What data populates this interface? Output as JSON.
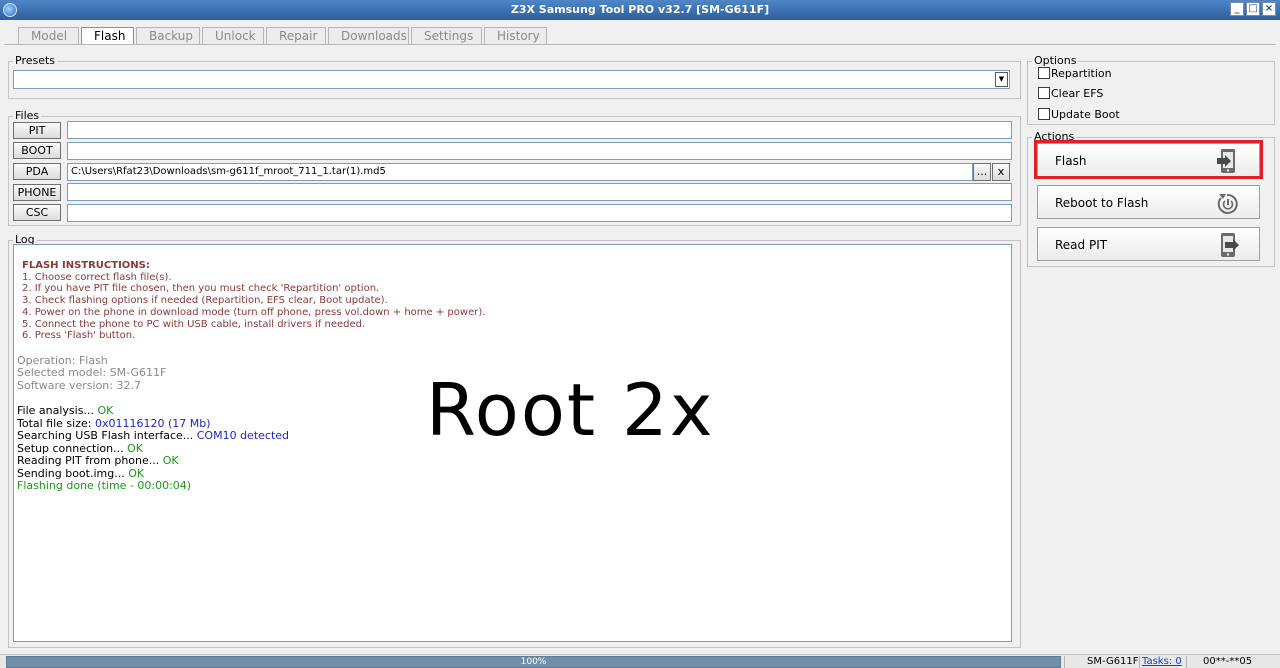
{
  "window": {
    "title": "Z3X Samsung Tool PRO v32.7 [SM-G611F]",
    "minimize": "_",
    "maximize": "□",
    "close": "×"
  },
  "tabs": [
    {
      "label": "Model"
    },
    {
      "label": "Flash",
      "active": true
    },
    {
      "label": "Backup"
    },
    {
      "label": "Unlock"
    },
    {
      "label": "Repair"
    },
    {
      "label": "Downloads"
    },
    {
      "label": "Settings"
    },
    {
      "label": "History"
    }
  ],
  "presets": {
    "title": "Presets",
    "value": "",
    "arrow": "▼"
  },
  "files": {
    "title": "Files",
    "rows": [
      {
        "label": "PIT",
        "value": ""
      },
      {
        "label": "BOOT",
        "value": ""
      },
      {
        "label": "PDA",
        "value": "C:\\Users\\Rfat23\\Downloads\\sm-g611f_mroot_711_1.tar(1).md5"
      },
      {
        "label": "PHONE",
        "value": ""
      },
      {
        "label": "CSC",
        "value": ""
      }
    ],
    "browse_label": "...",
    "clear_label": "x"
  },
  "log": {
    "title": "Log",
    "instructions_title": "FLASH INSTRUCTIONS:",
    "instructions": [
      "1. Choose correct flash file(s).",
      "2. If you have PIT file chosen, then you must check 'Repartition' option.",
      "3. Check flashing options if needed (Repartition, EFS clear, Boot update).",
      "4. Power on the phone in download mode (turn off phone, press vol.down + home + power).",
      "5. Connect the phone to PC with USB cable, install drivers if needed.",
      "6. Press 'Flash' button."
    ],
    "info": [
      "Operation: Flash",
      "Selected model: SM-G611F",
      "Software version: 32.7"
    ],
    "lines": [
      {
        "text": "File analysis... ",
        "result": "OK",
        "result_color": "ok"
      },
      {
        "text": "Total file size: ",
        "result": "0x01116120 (17 Mb)",
        "result_color": "blue"
      },
      {
        "text": "Searching USB Flash interface... ",
        "result": "COM10 detected",
        "result_color": "blue"
      },
      {
        "text": "Setup connection... ",
        "result": "OK",
        "result_color": "ok"
      },
      {
        "text": "Reading PIT from phone... ",
        "result": "OK",
        "result_color": "ok"
      },
      {
        "text": "Sending boot.img... ",
        "result": "OK",
        "result_color": "ok"
      }
    ],
    "done": "Flashing done (time - 00:00:04)",
    "overlay": "Root  2x"
  },
  "options": {
    "title": "Options",
    "checkboxes": [
      {
        "label": "Repartition",
        "checked": false
      },
      {
        "label": "Clear EFS",
        "checked": false
      },
      {
        "label": "Update Boot",
        "checked": false
      }
    ]
  },
  "actions": {
    "title": "Actions",
    "buttons": [
      {
        "label": "Flash",
        "icon": "phone-arrow-icon",
        "highlighted": true
      },
      {
        "label": "Reboot to Flash",
        "icon": "power-refresh-icon"
      },
      {
        "label": "Read PIT",
        "icon": "phone-arrow-icon"
      }
    ]
  },
  "status": {
    "progress": "100%",
    "progress_value": 100,
    "model": "SM-G611F",
    "tasks": "Tasks: 0",
    "code": "00**-**05"
  },
  "colors": {
    "ok": "#1a9a1a",
    "info": "#2323d0",
    "instructions": "#8b3a3a",
    "highlight": "#e21f26",
    "progress": "#6f8fa8"
  }
}
